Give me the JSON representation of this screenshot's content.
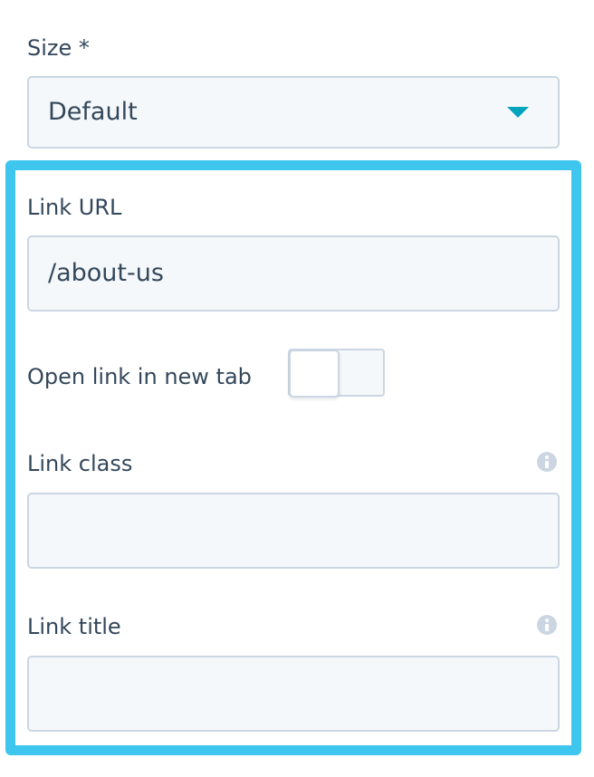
{
  "size": {
    "label": "Size *",
    "selected_value": "Default"
  },
  "link_url": {
    "label": "Link URL",
    "value": "/about-us"
  },
  "open_in_new_tab": {
    "label": "Open link in new tab",
    "enabled": false
  },
  "link_class": {
    "label": "Link class",
    "value": "",
    "info_icon": "info-icon"
  },
  "link_title": {
    "label": "Link title",
    "value": "",
    "info_icon": "info-icon"
  },
  "colors": {
    "text": "#33475b",
    "field_background": "#f5f8fa",
    "field_border": "#cbd6e2",
    "accent_caret": "#00a4bd",
    "highlight_border": "#3fc6ee"
  }
}
